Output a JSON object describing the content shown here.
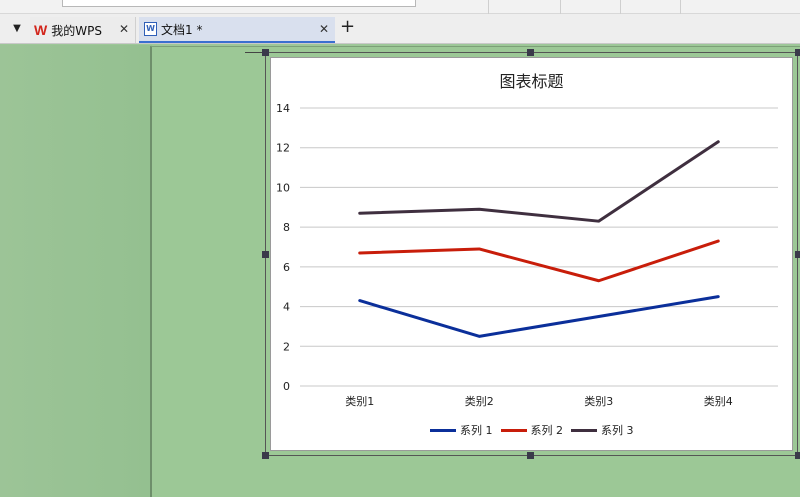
{
  "tabs": [
    {
      "label": "我的WPS",
      "logo": "W"
    },
    {
      "label": "文档1 *",
      "icon_text": "W"
    }
  ],
  "tab_close_glyph": "✕",
  "new_tab_glyph": "+",
  "menu_glyph": "▼",
  "colors": {
    "workspace": "#9dc798",
    "series1": "#0b2f9a",
    "series2": "#c81d0a",
    "series3": "#3f2f3f",
    "active_tab_accent": "#3a6fd0",
    "wps_red": "#d2261c"
  },
  "chart_data": {
    "type": "line",
    "title": "图表标题",
    "categories": [
      "类别1",
      "类别2",
      "类别3",
      "类别4"
    ],
    "series": [
      {
        "name": "系列 1",
        "values": [
          4.3,
          2.5,
          3.5,
          4.5
        ]
      },
      {
        "name": "系列 2",
        "values": [
          6.7,
          6.9,
          5.3,
          7.3
        ]
      },
      {
        "name": "系列 3",
        "values": [
          8.7,
          8.9,
          8.3,
          12.3
        ]
      }
    ],
    "yticks": [
      0,
      2,
      4,
      6,
      8,
      10,
      12,
      14
    ],
    "ylim": [
      0,
      14
    ],
    "grid": true,
    "legend": "bottom"
  }
}
